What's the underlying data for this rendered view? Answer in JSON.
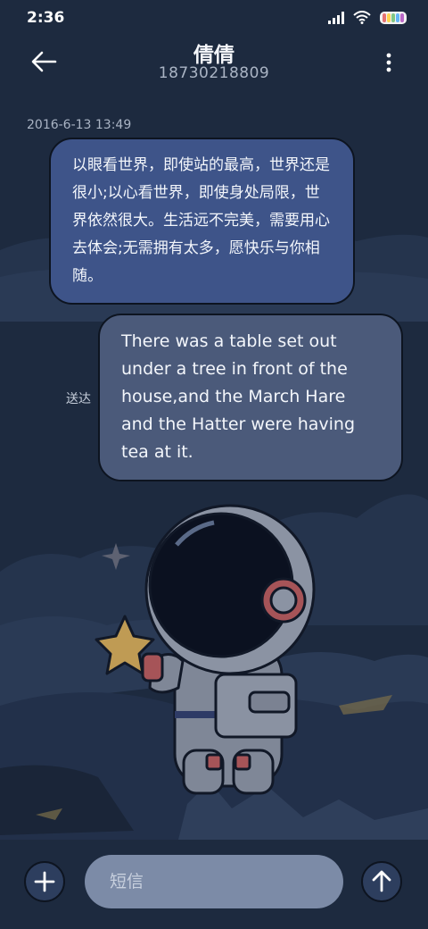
{
  "status_bar": {
    "time": "2:36",
    "icons": [
      "signal-icon",
      "wifi-icon",
      "battery-icon"
    ]
  },
  "header": {
    "contact_name": "倩倩",
    "phone_number": "18730218809",
    "back_icon": "arrow-left-icon",
    "more_icon": "vertical-dots-icon"
  },
  "conversation": {
    "timestamp": "2016-6-13 13:49",
    "messages": [
      {
        "text": "以眼看世界，即使站的最高，世界还是很小;以心看世界，即使身处局限，世界依然很大。生活远不完美，需要用心去体会;无需拥有太多，愿快乐与你相随。"
      },
      {
        "text": "There was a table set out under a tree in front of the house,and the March Hare and the Hatter were having tea at it.",
        "status": "送达"
      }
    ]
  },
  "composer": {
    "placeholder": "短信",
    "add_icon": "plus-icon",
    "send_icon": "arrow-up-icon"
  },
  "colors": {
    "background": "#1d2a3f",
    "bubble_received": "#3e5489",
    "bubble_sent": "#4b5a7a",
    "input_bg": "#7c8ba7"
  }
}
